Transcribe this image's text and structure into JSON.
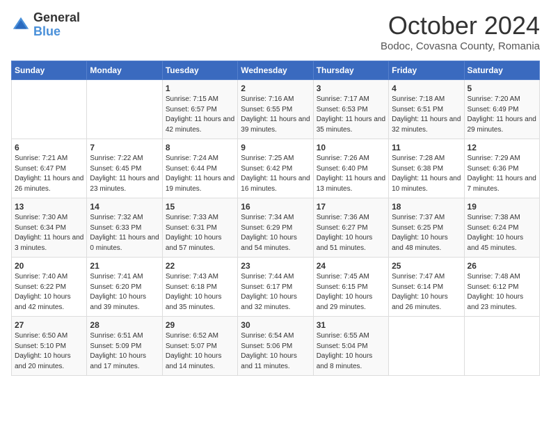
{
  "header": {
    "logo_general": "General",
    "logo_blue": "Blue",
    "month_title": "October 2024",
    "subtitle": "Bodoc, Covasna County, Romania"
  },
  "days_of_week": [
    "Sunday",
    "Monday",
    "Tuesday",
    "Wednesday",
    "Thursday",
    "Friday",
    "Saturday"
  ],
  "weeks": [
    [
      {
        "day": "",
        "sunrise": "",
        "sunset": "",
        "daylight": ""
      },
      {
        "day": "",
        "sunrise": "",
        "sunset": "",
        "daylight": ""
      },
      {
        "day": "1",
        "sunrise": "Sunrise: 7:15 AM",
        "sunset": "Sunset: 6:57 PM",
        "daylight": "Daylight: 11 hours and 42 minutes."
      },
      {
        "day": "2",
        "sunrise": "Sunrise: 7:16 AM",
        "sunset": "Sunset: 6:55 PM",
        "daylight": "Daylight: 11 hours and 39 minutes."
      },
      {
        "day": "3",
        "sunrise": "Sunrise: 7:17 AM",
        "sunset": "Sunset: 6:53 PM",
        "daylight": "Daylight: 11 hours and 35 minutes."
      },
      {
        "day": "4",
        "sunrise": "Sunrise: 7:18 AM",
        "sunset": "Sunset: 6:51 PM",
        "daylight": "Daylight: 11 hours and 32 minutes."
      },
      {
        "day": "5",
        "sunrise": "Sunrise: 7:20 AM",
        "sunset": "Sunset: 6:49 PM",
        "daylight": "Daylight: 11 hours and 29 minutes."
      }
    ],
    [
      {
        "day": "6",
        "sunrise": "Sunrise: 7:21 AM",
        "sunset": "Sunset: 6:47 PM",
        "daylight": "Daylight: 11 hours and 26 minutes."
      },
      {
        "day": "7",
        "sunrise": "Sunrise: 7:22 AM",
        "sunset": "Sunset: 6:45 PM",
        "daylight": "Daylight: 11 hours and 23 minutes."
      },
      {
        "day": "8",
        "sunrise": "Sunrise: 7:24 AM",
        "sunset": "Sunset: 6:44 PM",
        "daylight": "Daylight: 11 hours and 19 minutes."
      },
      {
        "day": "9",
        "sunrise": "Sunrise: 7:25 AM",
        "sunset": "Sunset: 6:42 PM",
        "daylight": "Daylight: 11 hours and 16 minutes."
      },
      {
        "day": "10",
        "sunrise": "Sunrise: 7:26 AM",
        "sunset": "Sunset: 6:40 PM",
        "daylight": "Daylight: 11 hours and 13 minutes."
      },
      {
        "day": "11",
        "sunrise": "Sunrise: 7:28 AM",
        "sunset": "Sunset: 6:38 PM",
        "daylight": "Daylight: 11 hours and 10 minutes."
      },
      {
        "day": "12",
        "sunrise": "Sunrise: 7:29 AM",
        "sunset": "Sunset: 6:36 PM",
        "daylight": "Daylight: 11 hours and 7 minutes."
      }
    ],
    [
      {
        "day": "13",
        "sunrise": "Sunrise: 7:30 AM",
        "sunset": "Sunset: 6:34 PM",
        "daylight": "Daylight: 11 hours and 3 minutes."
      },
      {
        "day": "14",
        "sunrise": "Sunrise: 7:32 AM",
        "sunset": "Sunset: 6:33 PM",
        "daylight": "Daylight: 11 hours and 0 minutes."
      },
      {
        "day": "15",
        "sunrise": "Sunrise: 7:33 AM",
        "sunset": "Sunset: 6:31 PM",
        "daylight": "Daylight: 10 hours and 57 minutes."
      },
      {
        "day": "16",
        "sunrise": "Sunrise: 7:34 AM",
        "sunset": "Sunset: 6:29 PM",
        "daylight": "Daylight: 10 hours and 54 minutes."
      },
      {
        "day": "17",
        "sunrise": "Sunrise: 7:36 AM",
        "sunset": "Sunset: 6:27 PM",
        "daylight": "Daylight: 10 hours and 51 minutes."
      },
      {
        "day": "18",
        "sunrise": "Sunrise: 7:37 AM",
        "sunset": "Sunset: 6:25 PM",
        "daylight": "Daylight: 10 hours and 48 minutes."
      },
      {
        "day": "19",
        "sunrise": "Sunrise: 7:38 AM",
        "sunset": "Sunset: 6:24 PM",
        "daylight": "Daylight: 10 hours and 45 minutes."
      }
    ],
    [
      {
        "day": "20",
        "sunrise": "Sunrise: 7:40 AM",
        "sunset": "Sunset: 6:22 PM",
        "daylight": "Daylight: 10 hours and 42 minutes."
      },
      {
        "day": "21",
        "sunrise": "Sunrise: 7:41 AM",
        "sunset": "Sunset: 6:20 PM",
        "daylight": "Daylight: 10 hours and 39 minutes."
      },
      {
        "day": "22",
        "sunrise": "Sunrise: 7:43 AM",
        "sunset": "Sunset: 6:18 PM",
        "daylight": "Daylight: 10 hours and 35 minutes."
      },
      {
        "day": "23",
        "sunrise": "Sunrise: 7:44 AM",
        "sunset": "Sunset: 6:17 PM",
        "daylight": "Daylight: 10 hours and 32 minutes."
      },
      {
        "day": "24",
        "sunrise": "Sunrise: 7:45 AM",
        "sunset": "Sunset: 6:15 PM",
        "daylight": "Daylight: 10 hours and 29 minutes."
      },
      {
        "day": "25",
        "sunrise": "Sunrise: 7:47 AM",
        "sunset": "Sunset: 6:14 PM",
        "daylight": "Daylight: 10 hours and 26 minutes."
      },
      {
        "day": "26",
        "sunrise": "Sunrise: 7:48 AM",
        "sunset": "Sunset: 6:12 PM",
        "daylight": "Daylight: 10 hours and 23 minutes."
      }
    ],
    [
      {
        "day": "27",
        "sunrise": "Sunrise: 6:50 AM",
        "sunset": "Sunset: 5:10 PM",
        "daylight": "Daylight: 10 hours and 20 minutes."
      },
      {
        "day": "28",
        "sunrise": "Sunrise: 6:51 AM",
        "sunset": "Sunset: 5:09 PM",
        "daylight": "Daylight: 10 hours and 17 minutes."
      },
      {
        "day": "29",
        "sunrise": "Sunrise: 6:52 AM",
        "sunset": "Sunset: 5:07 PM",
        "daylight": "Daylight: 10 hours and 14 minutes."
      },
      {
        "day": "30",
        "sunrise": "Sunrise: 6:54 AM",
        "sunset": "Sunset: 5:06 PM",
        "daylight": "Daylight: 10 hours and 11 minutes."
      },
      {
        "day": "31",
        "sunrise": "Sunrise: 6:55 AM",
        "sunset": "Sunset: 5:04 PM",
        "daylight": "Daylight: 10 hours and 8 minutes."
      },
      {
        "day": "",
        "sunrise": "",
        "sunset": "",
        "daylight": ""
      },
      {
        "day": "",
        "sunrise": "",
        "sunset": "",
        "daylight": ""
      }
    ]
  ]
}
